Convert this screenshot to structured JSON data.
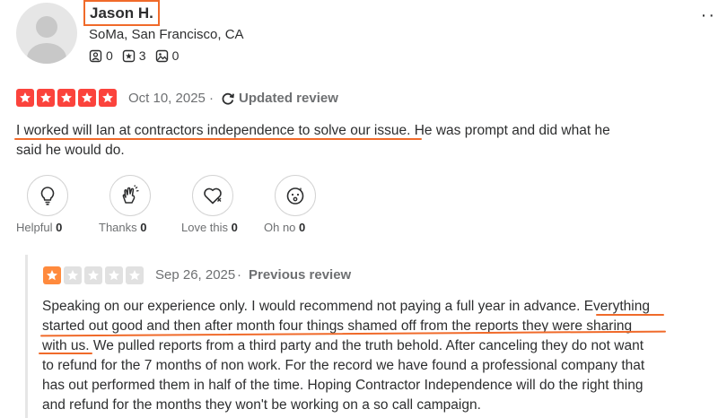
{
  "user": {
    "name": "Jason H.",
    "location": "SoMa, San Francisco, CA",
    "friends_count": "0",
    "reviews_count": "3",
    "photos_count": "0"
  },
  "current_review": {
    "rating": 5,
    "date": "Oct 10, 2025",
    "separator": "·",
    "status": "Updated review",
    "text_line1_underlined": "I worked will Ian at contractors independence to solve our issue.",
    "text_line1_rest": " He was prompt and did what he",
    "text_line2": "said he would do."
  },
  "reactions": [
    {
      "icon": "lightbulb-icon",
      "label": "Helpful",
      "count": "0"
    },
    {
      "icon": "clapping-hands-icon",
      "label": "Thanks",
      "count": "0"
    },
    {
      "icon": "heart-icon",
      "label": "Love this",
      "count": "0"
    },
    {
      "icon": "surprised-face-icon",
      "label": "Oh no",
      "count": "0"
    }
  ],
  "previous_review": {
    "rating": 1,
    "date": "Sep 26, 2025",
    "separator": "·",
    "status": "Previous review",
    "lines": [
      "Speaking on our experience only. I would recommend not paying a full year in advance. Everything",
      "started out good and then after month four things shamed off from the reports they were sharing",
      "with us. We pulled reports from a third party and the truth behold. After canceling they do not want",
      "to refund for the 7 months of non work. For the record we have found a professional company that",
      "has out performed them in half of the time. Hoping Contractor Independence will do the right thing",
      "and refund for the months they won't be working on a so call campaign."
    ]
  },
  "menu": {
    "more_label": "··"
  },
  "colors": {
    "star_red": "#fb433c",
    "star_orange": "#ff8a3d",
    "star_empty": "#e1e1e1",
    "highlight_orange": "#f06a2a"
  }
}
